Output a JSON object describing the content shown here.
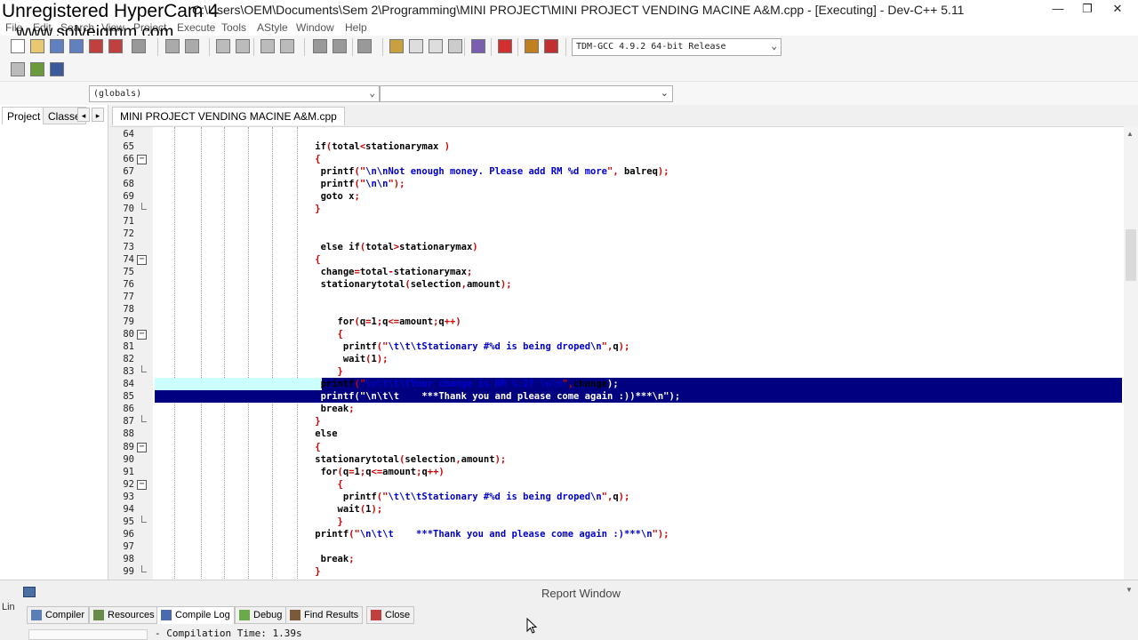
{
  "window": {
    "title": "C:\\Users\\OEM\\Documents\\Sem 2\\Programming\\MINI PROJECT\\MINI PROJECT VENDING MACINE A&M.cpp - [Executing] - Dev-C++ 5.11",
    "title_visible": "C:\\Users\\OEM\\Documents\\Sem 2\\Programming\\MINI PROJECT\\MINI PROJECT VENDING MACINE A&M.cpp - [Executing] - Dev-C++ 5.11",
    "minimize": "—",
    "restore": "❐",
    "close": "✕"
  },
  "watermark": {
    "line1": "Unregistered HyperCam 4",
    "line2": "www.solveigmm.com"
  },
  "menu": [
    "File",
    "Edit",
    "Search",
    "View",
    "Project",
    "Execute",
    "Tools",
    "AStyle",
    "Window",
    "Help"
  ],
  "toolbar": {
    "compiler": "TDM-GCC 4.9.2 64-bit Release",
    "icons": [
      "new-file-icon",
      "open-icon",
      "save-icon",
      "save-all-icon",
      "close-icon",
      "close-all-icon",
      "print-icon",
      "undo-icon",
      "redo-icon",
      "find-icon",
      "replace-icon",
      "indent-icon",
      "unindent-icon",
      "bookmark-back-icon",
      "bookmark-forward-icon",
      "toggle-icon",
      "compile-icon",
      "run-icon",
      "compile-run-icon",
      "rebuild-icon",
      "check-syntax-icon",
      "stop-icon",
      "chart-icon",
      "profile-icon"
    ]
  },
  "classbar": {
    "scope": "(globals)",
    "member": ""
  },
  "left_panel": {
    "tabs": [
      "Project",
      "Classe"
    ]
  },
  "editor": {
    "tab": "MINI PROJECT VENDING MACINE A&M.cpp",
    "lines": [
      {
        "n": "64",
        "code": ""
      },
      {
        "n": "65",
        "code": "            if(total<stationarymax )"
      },
      {
        "n": "66",
        "code": "            {"
      },
      {
        "n": "67",
        "code": "             printf(\"\\n\\nNot enough money. Please add RM %d more\", balreq);"
      },
      {
        "n": "68",
        "code": "             printf(\"\\n\\n\");"
      },
      {
        "n": "69",
        "code": "             goto x;"
      },
      {
        "n": "70",
        "code": "            }"
      },
      {
        "n": "71",
        "code": ""
      },
      {
        "n": "72",
        "code": ""
      },
      {
        "n": "73",
        "code": "             else if(total>stationarymax)"
      },
      {
        "n": "74",
        "code": "            {"
      },
      {
        "n": "75",
        "code": "             change=total-stationarymax;"
      },
      {
        "n": "76",
        "code": "             stationarytotal(selection,amount);"
      },
      {
        "n": "77",
        "code": ""
      },
      {
        "n": "78",
        "code": ""
      },
      {
        "n": "79",
        "code": "                for(q=1;q<=amount;q++)"
      },
      {
        "n": "80",
        "code": "                {"
      },
      {
        "n": "81",
        "code": "                 printf(\"\\t\\t\\tStationary #%d is being droped\\n\",q);"
      },
      {
        "n": "82",
        "code": "                 wait(1);"
      },
      {
        "n": "83",
        "code": "                }"
      },
      {
        "n": "84",
        "code": "             printf(\"\\n\\t\\t\\tYour change is RM %.2f \\n\\n\",change);"
      },
      {
        "n": "85",
        "code": "             printf(\"\\n\\t\\t    ***Thank you and please come again :))***\\n\");"
      },
      {
        "n": "86",
        "code": "             break;"
      },
      {
        "n": "87",
        "code": "            }"
      },
      {
        "n": "88",
        "code": "            else"
      },
      {
        "n": "89",
        "code": "            {"
      },
      {
        "n": "90",
        "code": "            stationarytotal(selection,amount);"
      },
      {
        "n": "91",
        "code": "             for(q=1;q<=amount;q++)"
      },
      {
        "n": "92",
        "code": "                {"
      },
      {
        "n": "93",
        "code": "                 printf(\"\\t\\t\\tStationary #%d is being droped\\n\",q);"
      },
      {
        "n": "94",
        "code": "                wait(1);"
      },
      {
        "n": "95",
        "code": "                }"
      },
      {
        "n": "96",
        "code": "            printf(\"\\n\\t\\t    ***Thank you and please come again :)***\\n\");"
      },
      {
        "n": "97",
        "code": ""
      },
      {
        "n": "98",
        "code": "             break;"
      },
      {
        "n": "99",
        "code": "            }"
      }
    ]
  },
  "report": {
    "title": "Report Window",
    "tabs": [
      "Compiler",
      "Resources",
      "Compile Log",
      "Debug",
      "Find Results",
      "Close"
    ],
    "log_line": "- Compilation Time: 1.39s",
    "left_label": "Lin"
  },
  "colors": {
    "selection": "#000080",
    "current_line": "#ccffff",
    "keyword_bracket": "#cc0000",
    "string": "#0000cc"
  }
}
